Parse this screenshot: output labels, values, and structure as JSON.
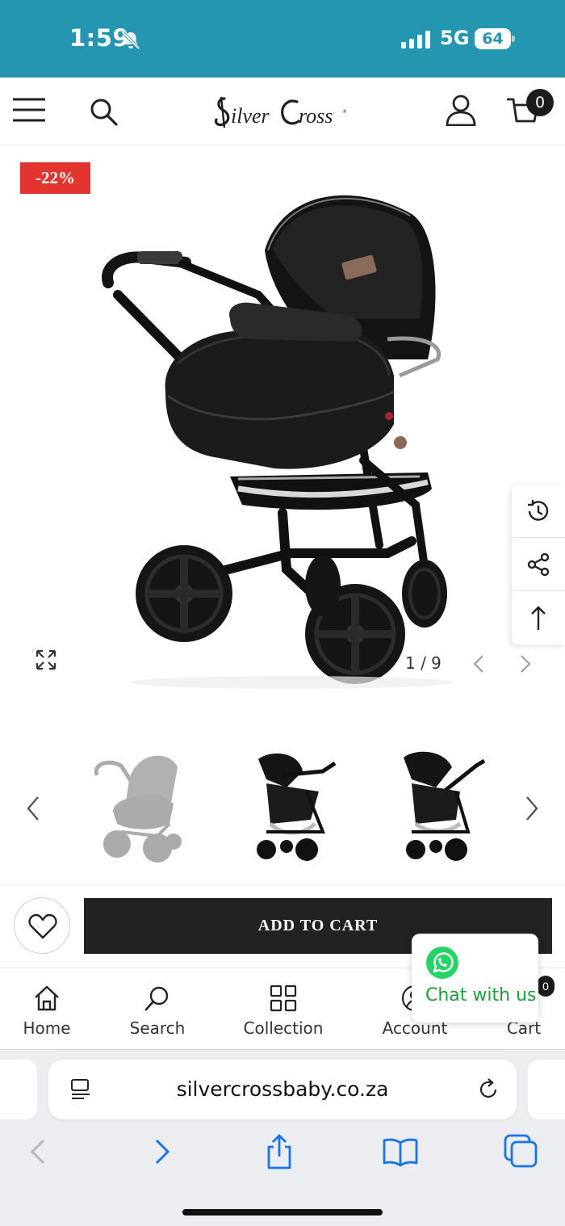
{
  "status_bar": {
    "time": "1:59",
    "network": "5G",
    "battery": "64",
    "icons": [
      "bell-slash-icon",
      "signal-icon",
      "battery-icon"
    ]
  },
  "header": {
    "brand": "Silver Cross",
    "cart_count": "0",
    "icons": [
      "menu-icon",
      "search-icon",
      "account-icon",
      "cart-icon"
    ]
  },
  "product": {
    "discount": "-22%",
    "image_counter": "1 / 9"
  },
  "side_tools": [
    "history-icon",
    "share-icon",
    "arrow-up-icon"
  ],
  "actions": {
    "add_to_cart": "ADD TO CART"
  },
  "bottom_nav": {
    "items": [
      {
        "label": "Home",
        "icon": "home-icon"
      },
      {
        "label": "Search",
        "icon": "search-icon"
      },
      {
        "label": "Collection",
        "icon": "grid-icon"
      },
      {
        "label": "Account",
        "icon": "account-icon"
      },
      {
        "label": "Cart",
        "icon": "cart-icon"
      }
    ]
  },
  "chat": {
    "label": "Chat with us"
  },
  "browser": {
    "url": "silvercrossbaby.co.za",
    "accent_color": "#1a73e8"
  },
  "colors": {
    "status_bar": "#2596b0",
    "badge": "#e3342f",
    "button": "#222222",
    "whatsapp": "#25d366"
  }
}
